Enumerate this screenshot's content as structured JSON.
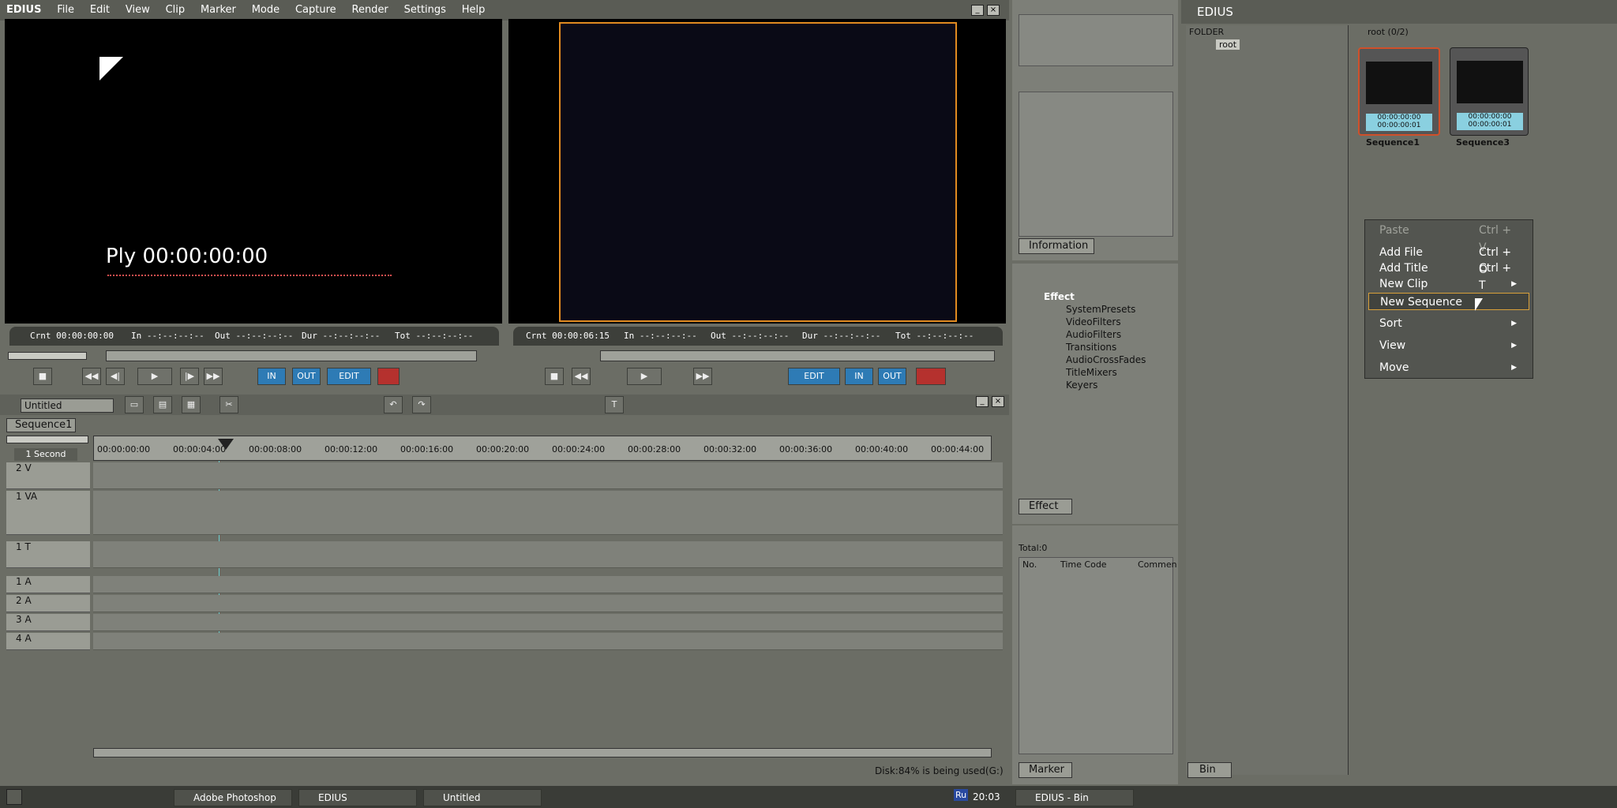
{
  "app": {
    "title": "EDIUS",
    "menu": [
      "File",
      "Edit",
      "View",
      "Clip",
      "Marker",
      "Mode",
      "Capture",
      "Render",
      "Settings",
      "Help"
    ]
  },
  "player": {
    "overlay": "Ply 00:00:00:00",
    "crnt": "Crnt 00:00:00:00",
    "in": "In --:--:--:--",
    "out": "Out --:--:--:--",
    "dur": "Dur --:--:--:--",
    "tot": "Tot --:--:--:--"
  },
  "recorder": {
    "crnt": "Crnt 00:00:06:15",
    "in": "In --:--:--:--",
    "out": "Out --:--:--:--",
    "dur": "Dur --:--:--:--",
    "tot": "Tot --:--:--:--"
  },
  "buttons": {
    "edit": "EDIT",
    "in": "IN",
    "out": "OUT"
  },
  "timeline": {
    "project_name": "Untitled",
    "sequence_tab": "Sequence1",
    "scale": "1 Second",
    "ticks": [
      "00:00:00:00",
      "00:00:04:00",
      "00:00:08:00",
      "00:00:12:00",
      "00:00:16:00",
      "00:00:20:00",
      "00:00:24:00",
      "00:00:28:00",
      "00:00:32:00",
      "00:00:36:00",
      "00:00:40:00",
      "00:00:44:00"
    ],
    "tracks": [
      "2 V",
      "1 VA",
      "1 T",
      "1 A",
      "2 A",
      "3 A",
      "4 A"
    ],
    "status": "Disk:84% is being used(G:)"
  },
  "info_panel": {
    "tab": "Information"
  },
  "effect_panel": {
    "tab": "Effect",
    "root": "Effect",
    "items": [
      "SystemPresets",
      "VideoFilters",
      "AudioFilters",
      "Transitions",
      "AudioCrossFades",
      "TitleMixers",
      "Keyers"
    ]
  },
  "marker_panel": {
    "tab": "Marker",
    "total": "Total:0",
    "columns": [
      "No.",
      "Time Code",
      "Commen"
    ]
  },
  "bin": {
    "title": "EDIUS",
    "folder_header": "FOLDER",
    "root": "root",
    "path": "root (0/2)",
    "tab": "Bin",
    "clips": [
      {
        "name": "Sequence1",
        "tc1": "00:00:00:00",
        "tc2": "00:00:00:01"
      },
      {
        "name": "Sequence3",
        "tc1": "00:00:00:00",
        "tc2": "00:00:00:01"
      }
    ]
  },
  "context_menu": {
    "items": [
      {
        "label": "Paste",
        "shortcut": "Ctrl + V"
      },
      {
        "label": "Add File",
        "shortcut": "Ctrl + O"
      },
      {
        "label": "Add Title",
        "shortcut": "Ctrl + T"
      },
      {
        "label": "New Clip",
        "shortcut": ""
      },
      {
        "label": "New Sequence",
        "shortcut": ""
      },
      {
        "label": "Sort",
        "shortcut": ""
      },
      {
        "label": "View",
        "shortcut": ""
      },
      {
        "label": "Move",
        "shortcut": ""
      }
    ]
  },
  "taskbar": {
    "tasks": [
      "Adobe Photoshop",
      "EDIUS",
      "Untitled"
    ],
    "clock": "20:03",
    "lang": "Ru",
    "bin_task": "EDIUS - Bin"
  }
}
